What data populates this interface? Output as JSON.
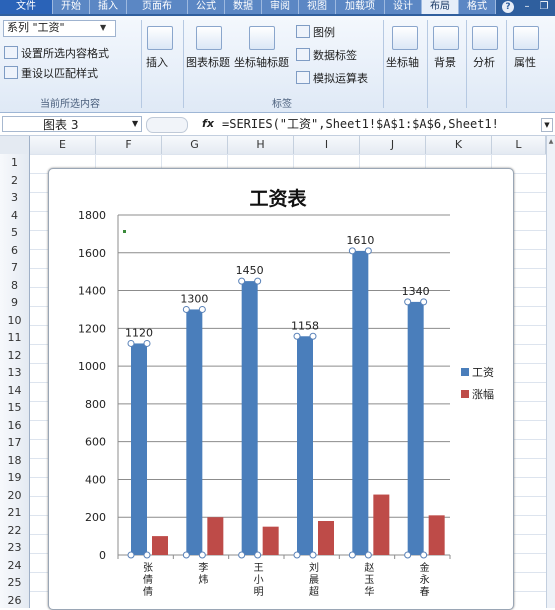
{
  "ribbon": {
    "tabs": [
      "文件",
      "开始",
      "插入",
      "页面布",
      "公式",
      "数据",
      "审阅",
      "视图",
      "加载项",
      "设计",
      "布局",
      "格式"
    ],
    "active_tab": "布局",
    "selection_combo": "系列 \"工资\"",
    "format_selection": "设置所选内容格式",
    "reset_style": "重设以匹配样式",
    "group_current": "当前所选内容",
    "insert": "插入",
    "chart_title": "图表标题",
    "axis_titles": "坐标轴标题",
    "legend": "图例",
    "data_labels": "数据标签",
    "data_table": "模拟运算表",
    "group_labels": "标签",
    "axes": "坐标轴",
    "background": "背景",
    "analysis": "分析",
    "properties": "属性"
  },
  "formula_bar": {
    "name_box": "图表 3",
    "fx": "fx",
    "formula": "=SERIES(\"工资\",Sheet1!$A$1:$A$6,Sheet1!"
  },
  "grid": {
    "columns": [
      "E",
      "F",
      "G",
      "H",
      "I",
      "J",
      "K",
      "L"
    ],
    "rows": [
      "1",
      "2",
      "3",
      "4",
      "5",
      "6",
      "7",
      "8",
      "9",
      "10",
      "11",
      "12",
      "13",
      "14",
      "15",
      "16",
      "17",
      "18",
      "19",
      "20",
      "21",
      "22",
      "23",
      "24",
      "25",
      "26"
    ]
  },
  "chart_data": {
    "type": "bar",
    "title": "工资表",
    "categories": [
      "张倩倩",
      "李炜",
      "王小明",
      "刘晨超",
      "赵玉华",
      "金永春"
    ],
    "series": [
      {
        "name": "工资",
        "values": [
          1120,
          1300,
          1450,
          1158,
          1610,
          1340
        ],
        "color": "#4a7ebb",
        "labels": [
          "1120",
          "1300",
          "1450",
          "1158",
          "1610",
          "1340"
        ]
      },
      {
        "name": "涨幅",
        "values": [
          100,
          200,
          150,
          180,
          320,
          210
        ],
        "color": "#be4b48"
      }
    ],
    "ylim": [
      0,
      1800
    ],
    "yticks": [
      "0",
      "200",
      "400",
      "600",
      "800",
      "1000",
      "1200",
      "1400",
      "1600",
      "1800"
    ],
    "grid": true,
    "legend_position": "right"
  }
}
